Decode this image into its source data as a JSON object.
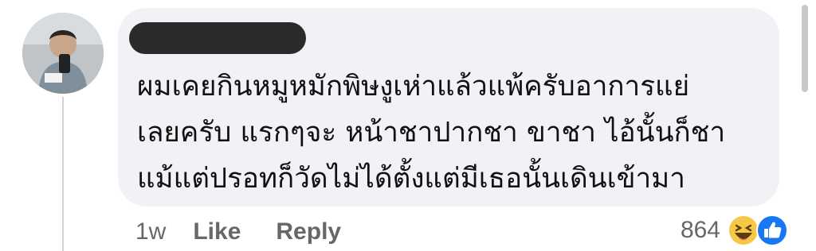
{
  "comment": {
    "lines": [
      "ผมเคยกินหมูหมักพิษงูเห่าแล้วแพ้ครับอาการแย่",
      "เลยครับ แรกๆจะ  หน้าชาปากชา ขาชา ไอ้นั้นก็ชา",
      "แม้แต่ปรอทก็วัดไม่ได้ตั้งแต่มีเธอนั้นเดินเข้ามา"
    ]
  },
  "actions": {
    "time": "1w",
    "like_label": "Like",
    "reply_label": "Reply"
  },
  "reactions": {
    "count": "864",
    "icons": [
      "haha-icon",
      "like-icon"
    ]
  },
  "colors": {
    "bubble": "#f0f2f5",
    "text": "#111111",
    "meta": "#65676b",
    "like_blue": "#1877f2",
    "haha_yellow": "#f7c846"
  }
}
